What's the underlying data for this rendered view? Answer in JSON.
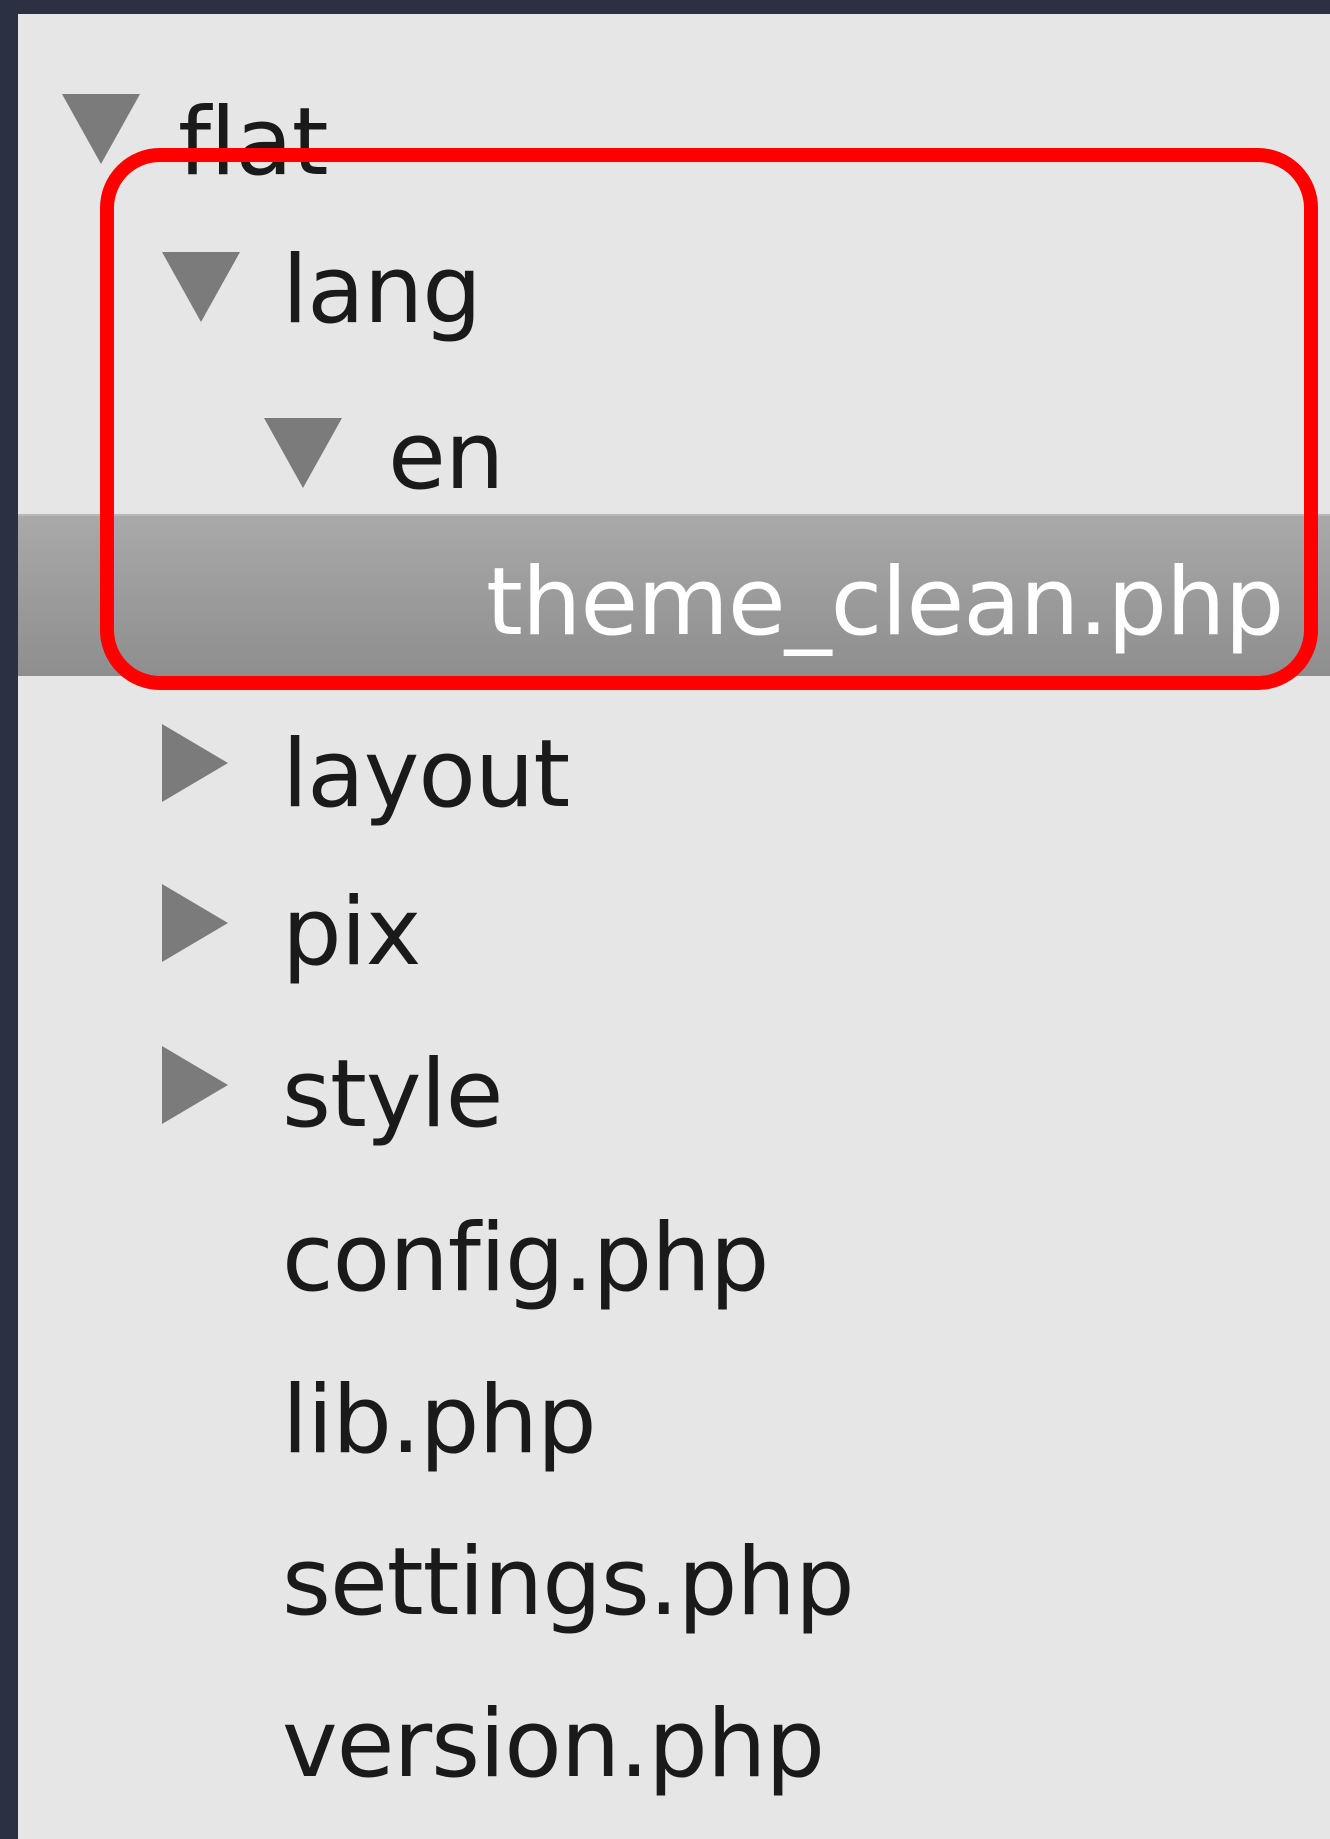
{
  "tree": {
    "items": [
      {
        "label": "flat",
        "expanded": true
      },
      {
        "label": "lang",
        "expanded": true
      },
      {
        "label": "en",
        "expanded": true
      },
      {
        "label": "theme_clean.php",
        "selected": true
      },
      {
        "label": "layout",
        "expanded": false
      },
      {
        "label": "pix",
        "expanded": false
      },
      {
        "label": "style",
        "expanded": false
      },
      {
        "label": "config.php"
      },
      {
        "label": "lib.php"
      },
      {
        "label": "settings.php"
      },
      {
        "label": "version.php"
      }
    ]
  },
  "colors": {
    "window_frame": "#2b3042",
    "panel_background": "#e6e6e6",
    "selection": "#9a9a9a",
    "annotation": "#ff0000",
    "disclosure_arrow": "#7b7b7b"
  }
}
